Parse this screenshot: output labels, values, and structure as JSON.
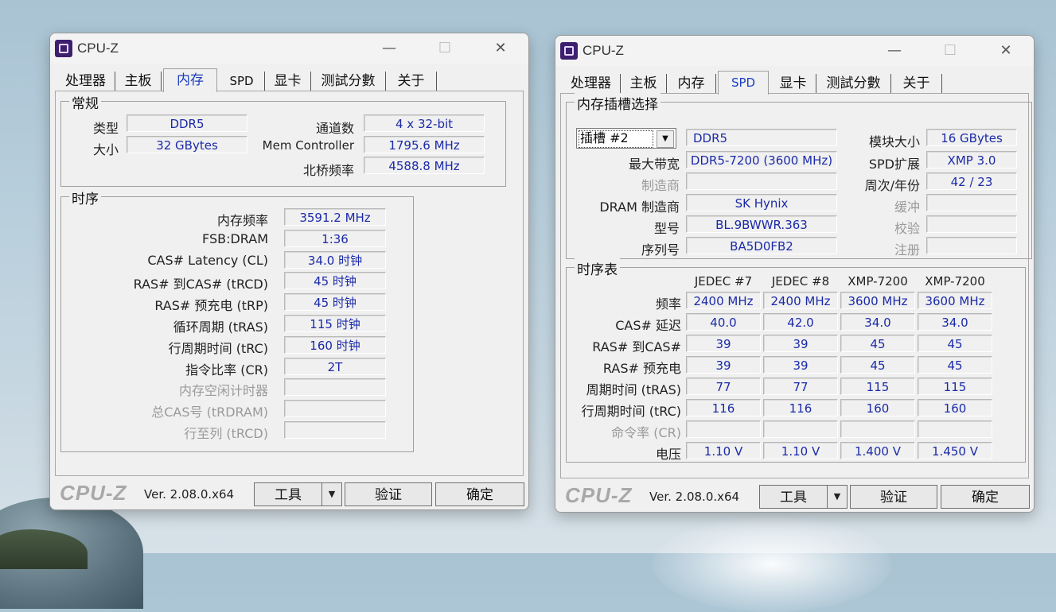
{
  "app_title": "CPU-Z",
  "tabs": [
    "处理器",
    "主板",
    "内存",
    "SPD",
    "显卡",
    "测試分數",
    "关于"
  ],
  "window_left": {
    "active_tab": "内存",
    "general": {
      "title": "常规",
      "type_label": "类型",
      "type_value": "DDR5",
      "size_label": "大小",
      "size_value": "32 GBytes",
      "channels_label": "通道数",
      "channels_value": "4 x 32-bit",
      "memctrl_label": "Mem Controller",
      "memctrl_value": "1795.6 MHz",
      "nb_label": "北桥频率",
      "nb_value": "4588.8 MHz"
    },
    "timings": {
      "title": "时序",
      "rows": [
        {
          "label": "内存频率",
          "value": "3591.2 MHz",
          "dim": false
        },
        {
          "label": "FSB:DRAM",
          "value": "1:36",
          "dim": false
        },
        {
          "label": "CAS# Latency (CL)",
          "value": "34.0 时钟",
          "dim": false
        },
        {
          "label": "RAS# 到CAS# (tRCD)",
          "value": "45 时钟",
          "dim": false
        },
        {
          "label": "RAS# 预充电 (tRP)",
          "value": "45 时钟",
          "dim": false
        },
        {
          "label": "循环周期 (tRAS)",
          "value": "115 时钟",
          "dim": false
        },
        {
          "label": "行周期时间 (tRC)",
          "value": "160 时钟",
          "dim": false
        },
        {
          "label": "指令比率 (CR)",
          "value": "2T",
          "dim": false
        },
        {
          "label": "内存空闲计时器",
          "value": "",
          "dim": true
        },
        {
          "label": "总CAS号 (tRDRAM)",
          "value": "",
          "dim": true
        },
        {
          "label": "行至列 (tRCD)",
          "value": "",
          "dim": true
        }
      ]
    }
  },
  "window_right": {
    "active_tab": "SPD",
    "slot": {
      "title": "内存插槽选择",
      "slot_value": "插槽 #2",
      "type_value": "DDR5",
      "module_size_label": "模块大小",
      "module_size_value": "16 GBytes",
      "max_bw_label": "最大带宽",
      "max_bw_value": "DDR5-7200 (3600 MHz)",
      "spd_ext_label": "SPD扩展",
      "spd_ext_value": "XMP 3.0",
      "manufacturer_label": "制造商",
      "manufacturer_value": "",
      "week_year_label": "周次/年份",
      "week_year_value": "42 / 23",
      "dram_mfr_label": "DRAM 制造商",
      "dram_mfr_value": "SK Hynix",
      "buffered_label": "缓冲",
      "buffered_value": "",
      "part_label": "型号",
      "part_value": "BL.9BWWR.363",
      "correction_label": "校验",
      "correction_value": "",
      "serial_label": "序列号",
      "serial_value": "BA5D0FB2",
      "registered_label": "注册",
      "registered_value": ""
    },
    "timing_table": {
      "title": "时序表",
      "columns": [
        "JEDEC #7",
        "JEDEC #8",
        "XMP-7200",
        "XMP-7200"
      ],
      "rows": [
        {
          "label": "频率",
          "values": [
            "2400 MHz",
            "2400 MHz",
            "3600 MHz",
            "3600 MHz"
          ],
          "dim": false
        },
        {
          "label": "CAS# 延迟",
          "values": [
            "40.0",
            "42.0",
            "34.0",
            "34.0"
          ],
          "dim": false
        },
        {
          "label": "RAS# 到CAS#",
          "values": [
            "39",
            "39",
            "45",
            "45"
          ],
          "dim": false
        },
        {
          "label": "RAS# 预充电",
          "values": [
            "39",
            "39",
            "45",
            "45"
          ],
          "dim": false
        },
        {
          "label": "周期时间 (tRAS)",
          "values": [
            "77",
            "77",
            "115",
            "115"
          ],
          "dim": false
        },
        {
          "label": "行周期时间 (tRC)",
          "values": [
            "116",
            "116",
            "160",
            "160"
          ],
          "dim": false
        },
        {
          "label": "命令率 (CR)",
          "values": [
            "",
            "",
            "",
            ""
          ],
          "dim": true
        },
        {
          "label": "电压",
          "values": [
            "1.10 V",
            "1.10 V",
            "1.400 V",
            "1.450 V"
          ],
          "dim": false
        }
      ]
    }
  },
  "footer": {
    "logo": "CPU-Z",
    "version": "Ver. 2.08.0.x64",
    "tools_label": "工具",
    "validate_label": "验证",
    "ok_label": "确定"
  },
  "icons": {
    "minimize": "—",
    "maximize": "☐",
    "close": "✕",
    "dropdown": "▼"
  }
}
